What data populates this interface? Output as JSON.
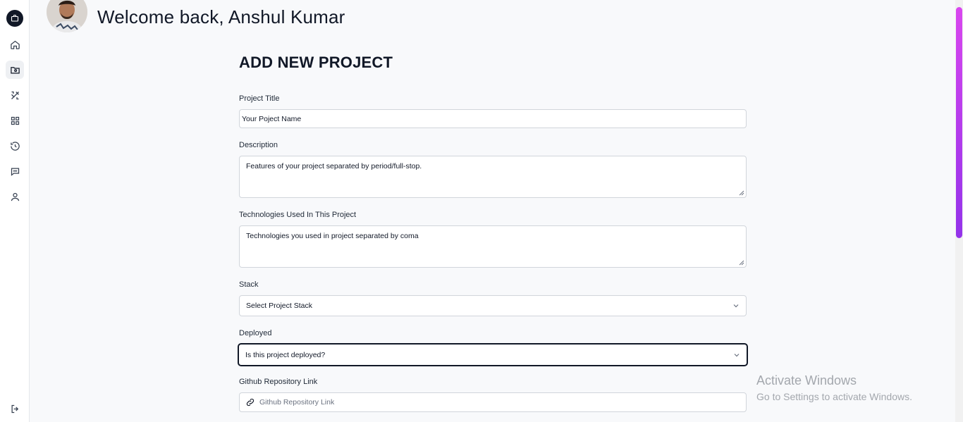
{
  "header": {
    "welcome": "Welcome back, Anshul Kumar"
  },
  "sidebar": {
    "items": [
      {
        "icon": "home-icon"
      },
      {
        "icon": "folder-icon",
        "active": true
      },
      {
        "icon": "tools-icon"
      },
      {
        "icon": "grid-icon"
      },
      {
        "icon": "history-icon"
      },
      {
        "icon": "chat-icon"
      },
      {
        "icon": "user-icon"
      }
    ],
    "logout_icon": "logout-icon"
  },
  "form": {
    "title": "ADD NEW PROJECT",
    "project_title_label": "Project Title",
    "project_title_value": "Your Poject Name",
    "description_label": "Description",
    "description_value": "Features of your project separated by period/full-stop.",
    "technologies_label": "Technologies Used In This Project",
    "technologies_value": "Technologies you used in project separated by coma",
    "stack_label": "Stack",
    "stack_selected": "Select Project Stack",
    "deployed_label": "Deployed",
    "deployed_selected": "Is this project deployed?",
    "github_label": "Github Repository Link",
    "github_placeholder": "Github Repository Link"
  },
  "watermark": {
    "line1": "Activate Windows",
    "line2": "Go to Settings to activate Windows."
  },
  "colors": {
    "accent_dark": "#111827",
    "scroll_top": "#d946ef",
    "scroll_bottom": "#9333ea"
  }
}
